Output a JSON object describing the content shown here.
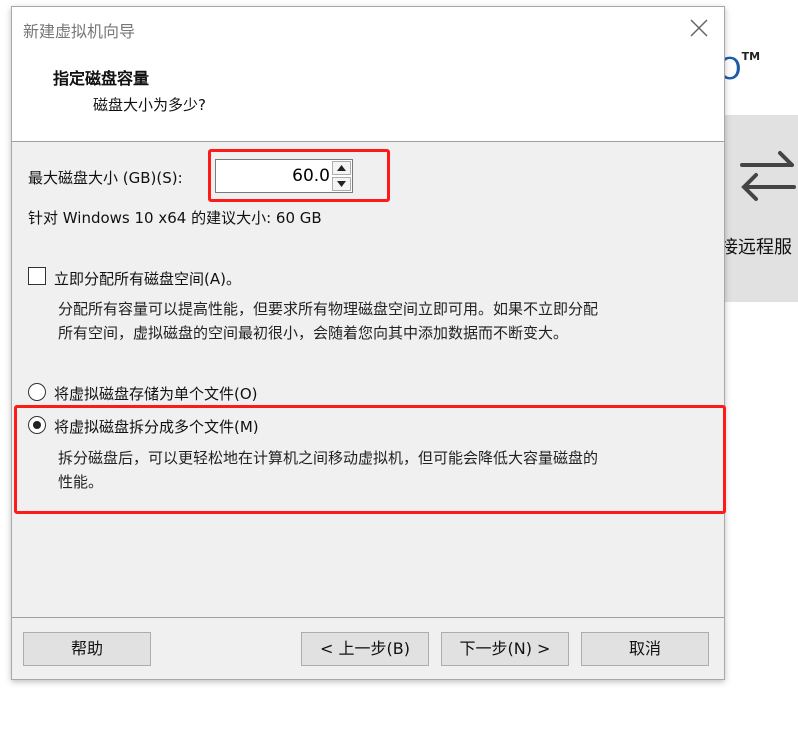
{
  "background_app": {
    "logo_suffix": "O",
    "trademark": "TM",
    "tile_label": "接远程服"
  },
  "dialog": {
    "title": "新建虚拟机向导",
    "header_title": "指定磁盘容量",
    "header_subtitle": "磁盘大小为多少?",
    "max_disk_label": "最大磁盘大小 (GB)(S):",
    "max_disk_value": "60.0",
    "recommended_text": "针对 Windows 10 x64 的建议大小: 60 GB",
    "allocate_label": "立即分配所有磁盘空间(A)。",
    "allocate_checked": false,
    "allocate_desc_line1": "分配所有容量可以提高性能，但要求所有物理磁盘空间立即可用。如果不立即分配",
    "allocate_desc_line2": "所有空间，虚拟磁盘的空间最初很小，会随着您向其中添加数据而不断变大。",
    "single_file_label": "将虚拟磁盘存储为单个文件(O)",
    "multi_file_label": "将虚拟磁盘拆分成多个文件(M)",
    "selected_option": "multi_file",
    "multi_desc_line1": "拆分磁盘后，可以更轻松地在计算机之间移动虚拟机，但可能会降低大容量磁盘的",
    "multi_desc_line2": "性能。",
    "buttons": {
      "help": "帮助",
      "back": "< 上一步(B)",
      "next": "下一步(N) >",
      "cancel": "取消"
    }
  },
  "colors": {
    "highlight": "#ff1a1a",
    "dialog_bg": "#f0f0f0",
    "logo_blue": "#1f5aa8"
  }
}
